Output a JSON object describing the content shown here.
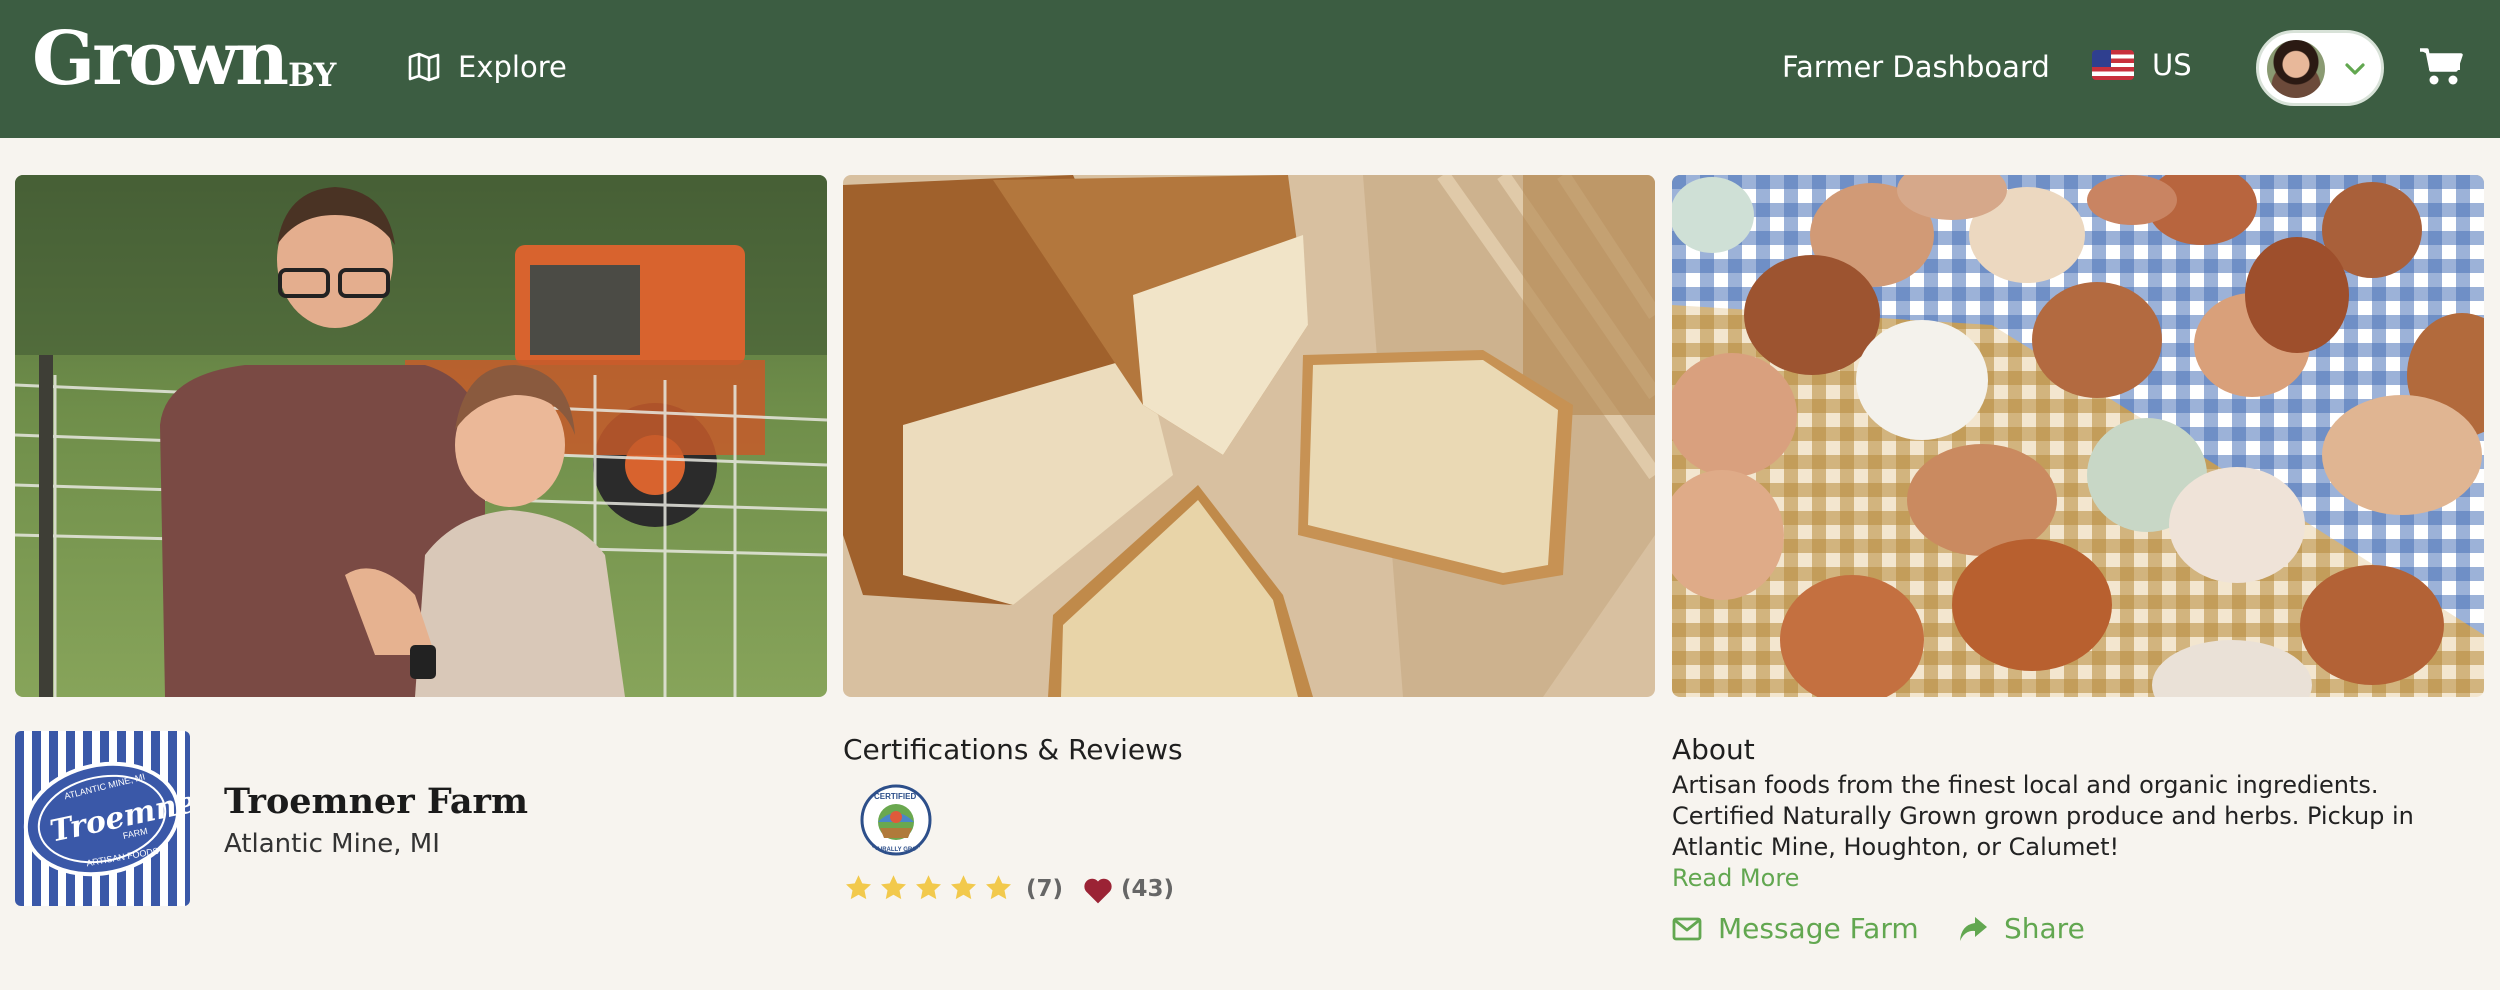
{
  "header": {
    "logo": {
      "main": "Grown",
      "suffix": "BY"
    },
    "explore_label": "Explore",
    "dashboard_label": "Farmer Dashboard",
    "locale_label": "US",
    "colors": {
      "bar": "#3c5d42",
      "text": "#ffffff"
    }
  },
  "photos": [
    {
      "subject": "farmers-portrait"
    },
    {
      "subject": "sliced-bread-loaves"
    },
    {
      "subject": "eggs-on-checkered-cloth"
    }
  ],
  "farm": {
    "name": "Troemner Farm",
    "location": "Atlantic Mine, MI",
    "logo_text": {
      "arc_top": "ATLANTIC MINE, MI",
      "script": "Troemner",
      "sub": "FARM",
      "arc_bottom": "ARTISAN FOODS"
    }
  },
  "certifications": {
    "title": "Certifications & Reviews",
    "badge_text": {
      "top": "CERTIFIED",
      "bottom": "NATURALLY GROWN"
    },
    "rating": 5,
    "review_count": "(7)",
    "favorites_count": "(43)",
    "colors": {
      "star": "#f2c94c",
      "heart": "#9b2335"
    }
  },
  "about": {
    "title": "About",
    "text": "Artisan foods from the finest local and organic ingredients. Certified Naturally Grown grown produce and herbs. Pickup in Atlantic Mine, Houghton, or Calumet!",
    "read_more": "Read More",
    "message_label": "Message Farm",
    "share_label": "Share",
    "accent": "#62a750"
  }
}
